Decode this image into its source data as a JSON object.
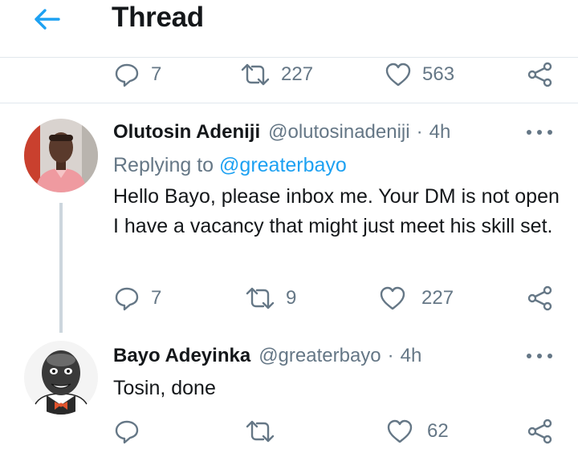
{
  "header": {
    "title": "Thread",
    "back_icon": "arrow-left-icon"
  },
  "colors": {
    "accent": "#1da1f2",
    "text": "#14171a",
    "muted": "#657786",
    "line": "#ccd6dd"
  },
  "top_actions": {
    "replies": "7",
    "retweets": "227",
    "likes": "563"
  },
  "tweets": [
    {
      "name": "Olutosin Adeniji",
      "handle": "@olutosinadeniji",
      "separator": "·",
      "time": "4h",
      "replying_label": "Replying to",
      "replying_to": "@greaterbayo",
      "text": "Hello Bayo, please inbox me. Your DM is not open I have a vacancy that might just meet his skill set.",
      "replies": "7",
      "retweets": "9",
      "likes": "227"
    },
    {
      "name": "Bayo Adeyinka",
      "handle": "@greaterbayo",
      "separator": "·",
      "time": "4h",
      "text": "Tosin, done",
      "replies": "",
      "retweets": "",
      "likes": "62"
    }
  ]
}
